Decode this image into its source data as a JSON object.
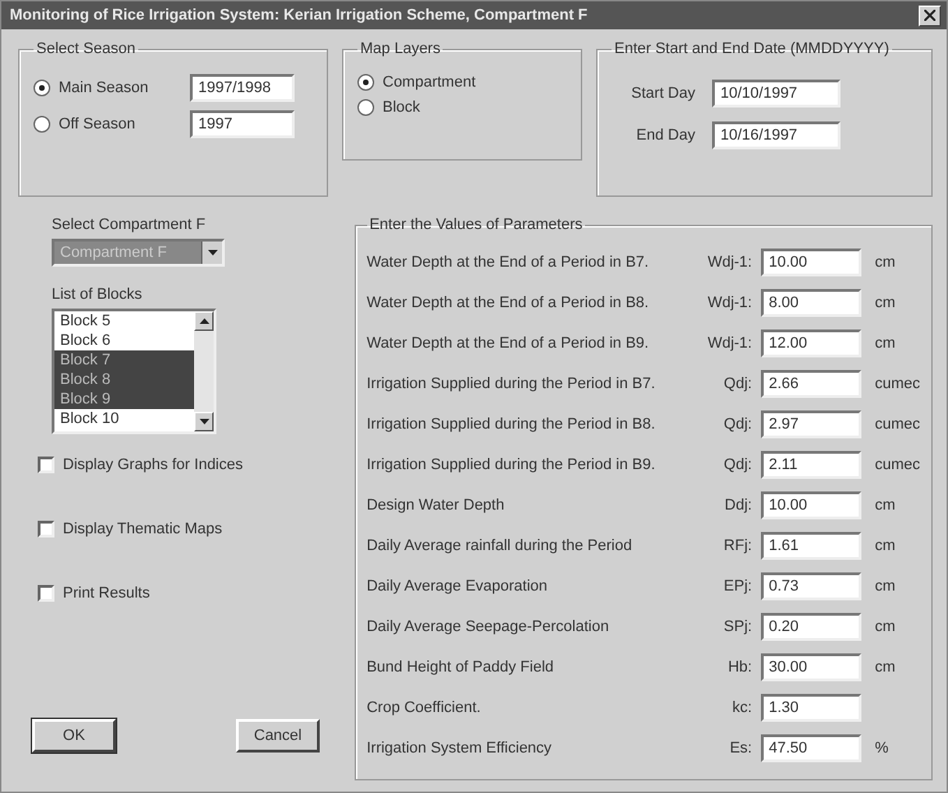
{
  "window": {
    "title": "Monitoring of Rice Irrigation System: Kerian Irrigation Scheme, Compartment F"
  },
  "season": {
    "title": "Select Season",
    "options": [
      {
        "label": "Main Season",
        "value": "1997/1998",
        "selected": true
      },
      {
        "label": "Off Season",
        "value": "1997",
        "selected": false
      }
    ]
  },
  "map_layers": {
    "title": "Map Layers",
    "options": [
      {
        "label": "Compartment",
        "selected": true
      },
      {
        "label": "Block",
        "selected": false
      }
    ]
  },
  "dates": {
    "title": "Enter Start and End Date (MMDDYYYY)",
    "fields": [
      {
        "label": "Start Day",
        "value": "10/10/1997"
      },
      {
        "label": "End Day",
        "value": "10/16/1997"
      }
    ]
  },
  "compartment": {
    "label": "Select Compartment F",
    "value": "Compartment F"
  },
  "blocks": {
    "label": "List of Blocks",
    "items": [
      {
        "label": "Block 5",
        "selected": false
      },
      {
        "label": "Block 6",
        "selected": false
      },
      {
        "label": "Block 7",
        "selected": true
      },
      {
        "label": "Block 8",
        "selected": true
      },
      {
        "label": "Block 9",
        "selected": true
      },
      {
        "label": "Block 10",
        "selected": false
      }
    ]
  },
  "checkboxes": [
    {
      "label": "Display Graphs for Indices",
      "checked": false
    },
    {
      "label": "Display Thematic Maps",
      "checked": false
    },
    {
      "label": "Print Results",
      "checked": false
    }
  ],
  "buttons": [
    "OK",
    "Cancel"
  ],
  "parameters": {
    "title": "Enter the Values of Parameters",
    "rows": [
      {
        "label": "Water Depth at the End of a Period in B7.",
        "symbol": "Wdj-1:",
        "value": "10.00",
        "unit": "cm"
      },
      {
        "label": "Water Depth at the End of a Period in B8.",
        "symbol": "Wdj-1:",
        "value": "8.00",
        "unit": "cm"
      },
      {
        "label": "Water Depth at the End of a Period in B9.",
        "symbol": "Wdj-1:",
        "value": "12.00",
        "unit": "cm"
      },
      {
        "label": "Irrigation Supplied during the Period in B7.",
        "symbol": "Qdj:",
        "value": "2.66",
        "unit": "cumec"
      },
      {
        "label": "Irrigation Supplied during the Period in B8.",
        "symbol": "Qdj:",
        "value": "2.97",
        "unit": "cumec"
      },
      {
        "label": "Irrigation Supplied during the Period in B9.",
        "symbol": "Qdj:",
        "value": "2.11",
        "unit": "cumec"
      },
      {
        "label": "Design Water Depth",
        "symbol": "Ddj:",
        "value": "10.00",
        "unit": "cm"
      },
      {
        "label": "Daily Average rainfall during the Period",
        "symbol": "RFj:",
        "value": "1.61",
        "unit": "cm"
      },
      {
        "label": "Daily Average Evaporation",
        "symbol": "EPj:",
        "value": "0.73",
        "unit": "cm"
      },
      {
        "label": "Daily Average Seepage-Percolation",
        "symbol": "SPj:",
        "value": "0.20",
        "unit": "cm"
      },
      {
        "label": "Bund Height of Paddy Field",
        "symbol": "Hb:",
        "value": "30.00",
        "unit": "cm"
      },
      {
        "label": "Crop Coefficient.",
        "symbol": "kc:",
        "value": "1.30"
      },
      {
        "label": "Irrigation System Efficiency",
        "symbol": "Es:",
        "value": "47.50",
        "unit": "%"
      }
    ]
  }
}
